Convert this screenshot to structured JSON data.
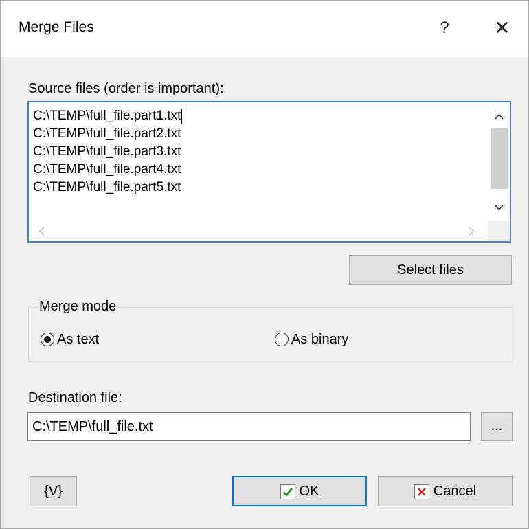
{
  "window": {
    "title": "Merge Files",
    "help_glyph": "?",
    "close_glyph": "✕"
  },
  "source": {
    "label": "Source files (order is important):",
    "files": [
      "C:\\TEMP\\full_file.part1.txt",
      "C:\\TEMP\\full_file.part2.txt",
      "C:\\TEMP\\full_file.part3.txt",
      "C:\\TEMP\\full_file.part4.txt",
      "C:\\TEMP\\full_file.part5.txt"
    ],
    "select_button": "Select files"
  },
  "merge_mode": {
    "label": "Merge mode",
    "options": [
      "As text",
      "As binary"
    ],
    "selected": "As text"
  },
  "destination": {
    "label": "Destination file:",
    "value": "C:\\TEMP\\full_file.txt",
    "browse_button": "..."
  },
  "buttons": {
    "variables": "{V}",
    "ok": "OK",
    "cancel": "Cancel"
  },
  "icons": {
    "help": "help-icon",
    "close": "close-icon",
    "ok": "check-icon",
    "cancel": "x-icon",
    "scroll_up": "chevron-up-icon",
    "scroll_down": "chevron-down-icon",
    "scroll_left": "chevron-left-icon",
    "scroll_right": "chevron-right-icon"
  },
  "colors": {
    "focus": "#3c7fd9",
    "check": "#1e8c1e",
    "cancel_x": "#d9241c"
  }
}
